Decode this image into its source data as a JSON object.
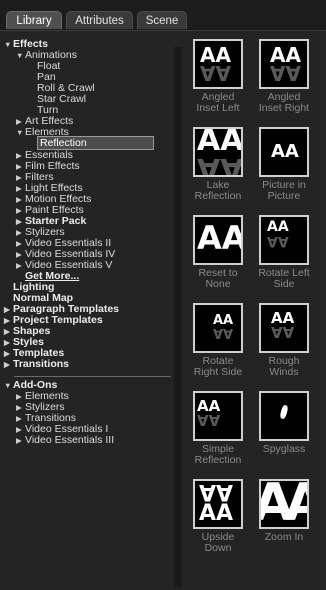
{
  "tabs": [
    {
      "label": "Library",
      "active": true
    },
    {
      "label": "Attributes",
      "active": false
    },
    {
      "label": "Scene",
      "active": false
    }
  ],
  "tree": [
    {
      "label": "Effects",
      "bold": true,
      "twisty": "down"
    },
    {
      "label": "Animations",
      "twisty": "down"
    },
    {
      "label": "Float",
      "twisty": ""
    },
    {
      "label": "Pan",
      "twisty": ""
    },
    {
      "label": "Roll & Crawl",
      "twisty": ""
    },
    {
      "label": "Star Crawl",
      "twisty": ""
    },
    {
      "label": "Turn",
      "twisty": ""
    },
    {
      "label": "Art Effects",
      "twisty": "right"
    },
    {
      "label": "Elements",
      "twisty": "down"
    },
    {
      "label": "Reflection",
      "twisty": "",
      "selected": true
    },
    {
      "label": "Essentials",
      "twisty": "right"
    },
    {
      "label": "Film Effects",
      "twisty": "right"
    },
    {
      "label": "Filters",
      "twisty": "right"
    },
    {
      "label": "Light Effects",
      "twisty": "right"
    },
    {
      "label": "Motion Effects",
      "twisty": "right"
    },
    {
      "label": "Paint Effects",
      "twisty": "right"
    },
    {
      "label": "Starter Pack",
      "twisty": "right",
      "bold": true
    },
    {
      "label": "Stylizers",
      "twisty": "right"
    },
    {
      "label": "Video Essentials II",
      "twisty": "right"
    },
    {
      "label": "Video Essentials IV",
      "twisty": "right"
    },
    {
      "label": "Video Essentials V",
      "twisty": "right"
    },
    {
      "label": "Get More...",
      "twisty": "",
      "bold": true,
      "link": true
    },
    {
      "label": "Lighting",
      "bold": true,
      "twisty": ""
    },
    {
      "label": "Normal Map",
      "bold": true,
      "twisty": ""
    },
    {
      "label": "Paragraph Templates",
      "bold": true,
      "twisty": "right"
    },
    {
      "label": "Project Templates",
      "bold": true,
      "twisty": "right"
    },
    {
      "label": "Shapes",
      "bold": true,
      "twisty": "right"
    },
    {
      "label": "Styles",
      "bold": true,
      "twisty": "right"
    },
    {
      "label": "Templates",
      "bold": true,
      "twisty": "right"
    },
    {
      "label": "Transitions",
      "bold": true,
      "twisty": "right"
    }
  ],
  "addons": [
    {
      "label": "Add-Ons",
      "bold": true,
      "twisty": "down"
    },
    {
      "label": "Elements",
      "twisty": "right"
    },
    {
      "label": "Stylizers",
      "twisty": "right"
    },
    {
      "label": "Transitions",
      "twisty": "right"
    },
    {
      "label": "Video Essentials I",
      "twisty": "right"
    },
    {
      "label": "Video Essentials III",
      "twisty": "right"
    }
  ],
  "presets": [
    {
      "line1": "Angled",
      "line2": "Inset Left",
      "thumb_text": "AA"
    },
    {
      "line1": "Angled",
      "line2": "Inset Right",
      "thumb_text": "AA"
    },
    {
      "line1": "Lake",
      "line2": "Reflection",
      "thumb_text": "AA"
    },
    {
      "line1": "Picture in",
      "line2": "Picture",
      "thumb_text": "AA"
    },
    {
      "line1": "Reset to",
      "line2": "None",
      "thumb_text": "AA"
    },
    {
      "line1": "Rotate Left",
      "line2": "Side",
      "thumb_text": "AA"
    },
    {
      "line1": "Rotate",
      "line2": "Right Side",
      "thumb_text": "AA"
    },
    {
      "line1": "Rough",
      "line2": "Winds",
      "thumb_text": "AA"
    },
    {
      "line1": "Simple",
      "line2": "Reflection",
      "thumb_text": "AA"
    },
    {
      "line1": "Spyglass",
      "line2": "",
      "thumb_text": ""
    },
    {
      "line1": "Upside",
      "line2": "Down",
      "thumb_text": "AA"
    },
    {
      "line1": "Zoom In",
      "line2": "",
      "thumb_text": ""
    }
  ]
}
